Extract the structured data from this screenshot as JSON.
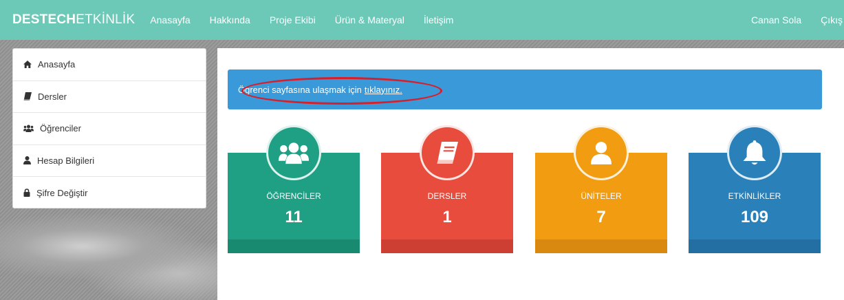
{
  "navbar": {
    "brand_bold": "DESTECH",
    "brand_rest": "ETKİNLİK",
    "links": [
      "Anasayfa",
      "Hakkında",
      "Proje Ekibi",
      "Ürün & Materyal",
      "İletişim"
    ],
    "user": "Canan Sola",
    "logout": "Çıkış"
  },
  "sidebar": {
    "items": [
      {
        "label": "Anasayfa",
        "icon": "home-icon"
      },
      {
        "label": "Dersler",
        "icon": "book-icon"
      },
      {
        "label": "Öğrenciler",
        "icon": "users-icon"
      },
      {
        "label": "Hesap Bilgileri",
        "icon": "user-icon"
      },
      {
        "label": "Şifre Değiştir",
        "icon": "lock-icon"
      }
    ]
  },
  "alert": {
    "text": "Öğrenci sayfasına ulaşmak için",
    "link": "tıklayınız."
  },
  "cards": [
    {
      "label": "ÖĞRENCİLER",
      "count": "11",
      "icon": "users-icon",
      "color": "#1fa084",
      "dark": "#178a70"
    },
    {
      "label": "DERSLER",
      "count": "1",
      "icon": "book-icon",
      "color": "#e84c3d",
      "dark": "#cd3f33"
    },
    {
      "label": "ÜNİTELER",
      "count": "7",
      "icon": "user-icon",
      "color": "#f29c12",
      "dark": "#d98810"
    },
    {
      "label": "ETKİNLİKLER",
      "count": "109",
      "icon": "bell-icon",
      "color": "#2a80b9",
      "dark": "#236fa3"
    }
  ]
}
